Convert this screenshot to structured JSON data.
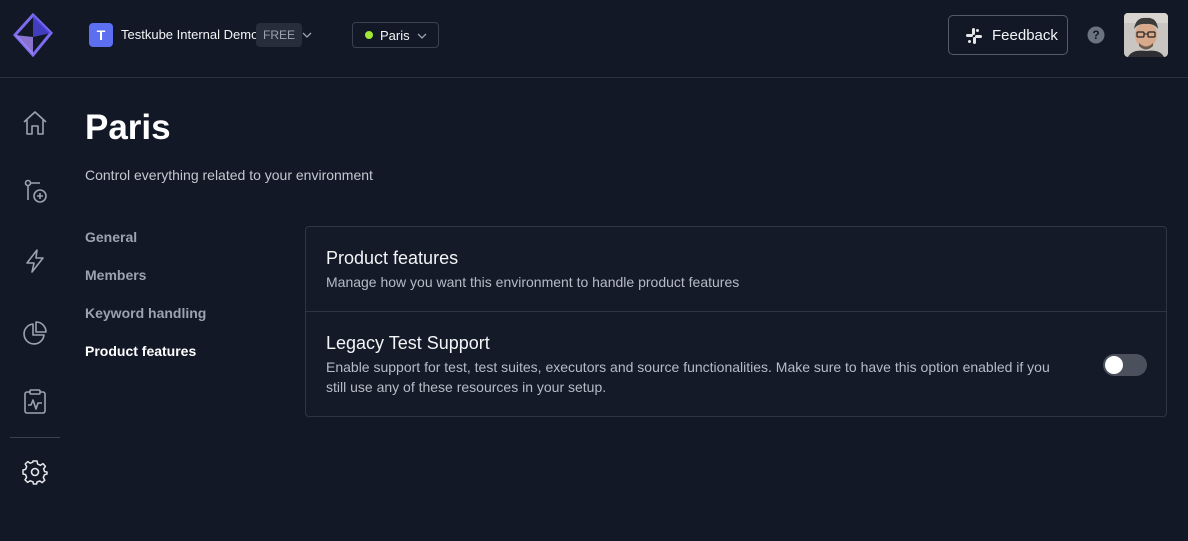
{
  "header": {
    "org_initial": "T",
    "org_name": "Testkube Internal Demo",
    "plan": "FREE",
    "environment": {
      "name": "Paris",
      "status_color": "#a3e635"
    },
    "feedback_label": "Feedback",
    "accent_color": "#5b6ff0"
  },
  "sidebar": {
    "items": [
      {
        "icon": "home-icon"
      },
      {
        "icon": "add-test-icon"
      },
      {
        "icon": "lightning-icon"
      },
      {
        "icon": "pie-chart-icon"
      },
      {
        "icon": "clipboard-monitor-icon"
      },
      {
        "icon": "gear-icon"
      }
    ]
  },
  "page": {
    "title": "Paris",
    "subtitle": "Control everything related to your environment"
  },
  "settings_nav": {
    "items": [
      {
        "label": "General",
        "active": false
      },
      {
        "label": "Members",
        "active": false
      },
      {
        "label": "Keyword handling",
        "active": false
      },
      {
        "label": "Product features",
        "active": true
      }
    ]
  },
  "panel": {
    "title": "Product features",
    "description": "Manage how you want this environment to handle product features",
    "settings": [
      {
        "title": "Legacy Test Support",
        "description": "Enable support for test, test suites, executors and source functionalities. Make sure to have this option enabled if you still use any of these resources in your setup.",
        "enabled": false
      }
    ]
  }
}
